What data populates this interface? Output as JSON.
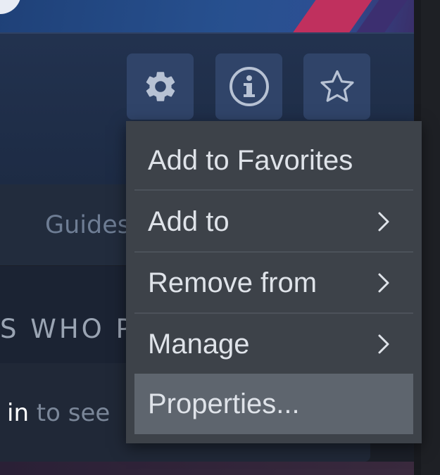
{
  "toolbar": {
    "buttons": [
      {
        "icon": "gear-icon"
      },
      {
        "icon": "info-icon"
      },
      {
        "icon": "star-outline-icon"
      }
    ]
  },
  "background": {
    "guides_label": "Guides",
    "players_heading": "S WHO P",
    "signin_strong": "in",
    "signin_rest": " to see"
  },
  "context_menu": {
    "items": [
      {
        "label": "Add to Favorites",
        "has_submenu": false,
        "highlighted": false
      },
      {
        "label": "Add to",
        "has_submenu": true,
        "highlighted": false
      },
      {
        "label": "Remove from",
        "has_submenu": true,
        "highlighted": false
      },
      {
        "label": "Manage",
        "has_submenu": true,
        "highlighted": false
      },
      {
        "label": "Properties...",
        "has_submenu": false,
        "highlighted": true
      }
    ]
  },
  "colors": {
    "menu_bg": "#3d4249",
    "menu_highlight": "#5e656e",
    "tile_bg": "#304469",
    "icon_color": "#b7c2d4"
  }
}
